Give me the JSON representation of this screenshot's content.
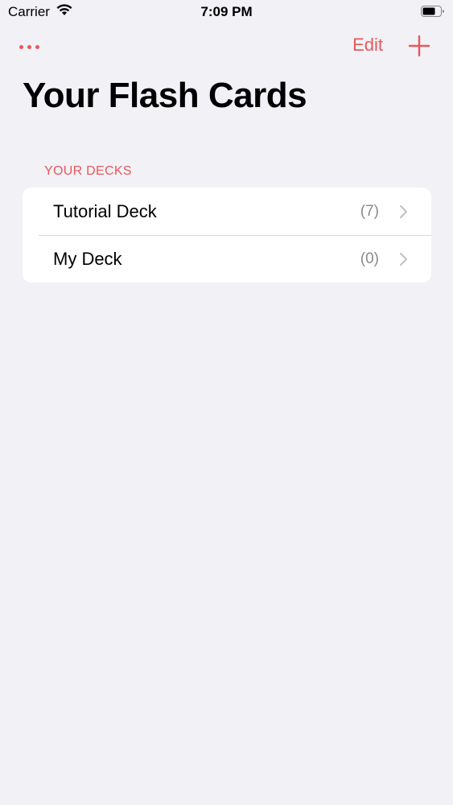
{
  "status_bar": {
    "carrier": "Carrier",
    "wifi_icon": "wifi-icon",
    "time": "7:09 PM",
    "battery_icon": "battery-icon"
  },
  "nav": {
    "more_icon": "ellipsis-icon",
    "edit_label": "Edit",
    "add_icon": "plus-icon",
    "accent_color": "#e8585a"
  },
  "page": {
    "title": "Your Flash Cards"
  },
  "decks_section": {
    "header": "YOUR DECKS",
    "items": [
      {
        "name": "Tutorial Deck",
        "count": "(7)"
      },
      {
        "name": "My Deck",
        "count": "(0)"
      }
    ]
  },
  "colors": {
    "background": "#f2f1f6",
    "accent": "#e8585a",
    "secondary_text": "#8a8a8e"
  }
}
